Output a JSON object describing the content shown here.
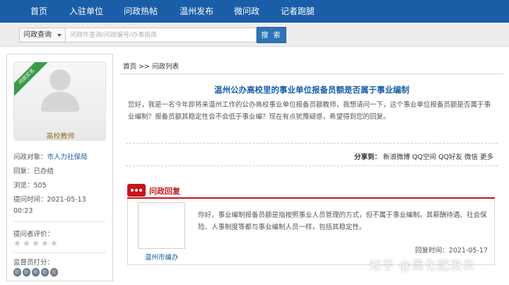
{
  "nav": {
    "items": [
      "首页",
      "入驻单位",
      "问政热帖",
      "温州发布",
      "微问政",
      "记者跑腿"
    ]
  },
  "search": {
    "category": "问政查询",
    "placeholder": "问政件查询/问政编号/办事指南",
    "button": "搜 索"
  },
  "sidebar": {
    "ribbon": "问政实名",
    "avatar_caption": "高校教师",
    "target_label": "问政对象：",
    "target_value": "市人力社保局",
    "reply_label": "回复：",
    "reply_value": "已办结",
    "views_label": "浏览：",
    "views_value": "505",
    "time_label": "提问时间：",
    "time_value_line1": "2021-05-13",
    "time_value_line2": "00:23",
    "rating_label": "提问者评价：",
    "rating_stars": 5,
    "rating_filled": 0,
    "supervisor_label": "监督员打分：",
    "medal_count": 5
  },
  "main": {
    "breadcrumb": "首页 >> 问政列表",
    "question_title": "温州公办高校里的事业单位报备员额是否属于事业编制",
    "question_body": "您好，我是一名今年即将来温州工作的公办高校事业单位报备员额教师，我想请问一下，这个事业单位报备员额是否属于事业编制？报备员额其稳定性会不会低于事业编？现在有点犹豫疑惑，希望得到您的回复。",
    "share_label": "分享到：",
    "share_links": [
      "新浪微博",
      "QQ空间",
      "QQ好友",
      "微信",
      "更多"
    ],
    "reply_header": "问政回复",
    "reply_dept": "温州市编办",
    "reply_text": "你好，事业编制报备员额是指按照事业人员管理的方式，但不属于事业编制。其薪酬待遇、社会保险、人事制度等都与事业编制人员一样，包括其稳定性。",
    "reply_time": "回复时间：2021-05-17"
  },
  "watermark": "知乎 @黑化肥发灰",
  "colors": {
    "nav_bg": "#1a5ea8",
    "link_blue": "#1a5ea8",
    "reply_red": "#c4161c",
    "search_button": "#2f73b8"
  }
}
